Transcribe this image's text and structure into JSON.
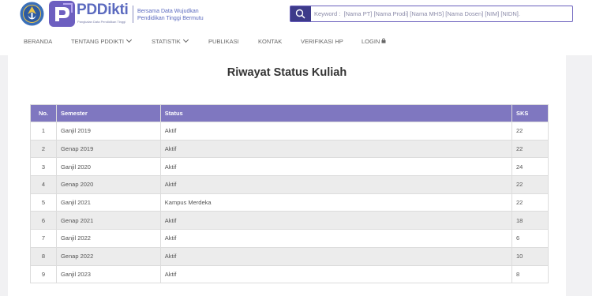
{
  "brand": {
    "name": "PDDikti",
    "subtitle": "Pangkalan Data Pendidikan Tinggi",
    "slogan_line1": "Bersama Data Wujudkan",
    "slogan_line2": "Pendidikan Tinggi Bermutu"
  },
  "search": {
    "placeholder": "Keyword :  [Nama PT] [Nama Prodi] [Nama MHS] [Nama Dosen] [NIM] [NIDN]."
  },
  "nav": {
    "beranda": "BERANDA",
    "tentang": "TENTANG PDDIKTI",
    "statistik": "STATISTIK",
    "publikasi": "PUBLIKASI",
    "kontak": "KONTAK",
    "verifikasi": "VERIFIKASI HP",
    "login": "LOGIN"
  },
  "page": {
    "title": "Riwayat Status Kuliah"
  },
  "table": {
    "headers": {
      "no": "No.",
      "semester": "Semester",
      "status": "Status",
      "sks": "SKS"
    },
    "rows": [
      {
        "no": "1",
        "semester": "Ganjil 2019",
        "status": "Aktif",
        "sks": "22"
      },
      {
        "no": "2",
        "semester": "Genap 2019",
        "status": "Aktif",
        "sks": "22"
      },
      {
        "no": "3",
        "semester": "Ganjil 2020",
        "status": "Aktif",
        "sks": "24"
      },
      {
        "no": "4",
        "semester": "Genap 2020",
        "status": "Aktif",
        "sks": "22"
      },
      {
        "no": "5",
        "semester": "Ganjil 2021",
        "status": "Kampus Merdeka",
        "sks": "22"
      },
      {
        "no": "6",
        "semester": "Genap 2021",
        "status": "Aktif",
        "sks": "18"
      },
      {
        "no": "7",
        "semester": "Ganjil 2022",
        "status": "Aktif",
        "sks": "6"
      },
      {
        "no": "8",
        "semester": "Genap 2022",
        "status": "Aktif",
        "sks": "10"
      },
      {
        "no": "9",
        "semester": "Ganjil 2023",
        "status": "Aktif",
        "sks": "8"
      }
    ]
  },
  "colors": {
    "header_bg": "#7f77c0",
    "search_button": "#3d3a8a",
    "brand": "#5b6abf"
  }
}
